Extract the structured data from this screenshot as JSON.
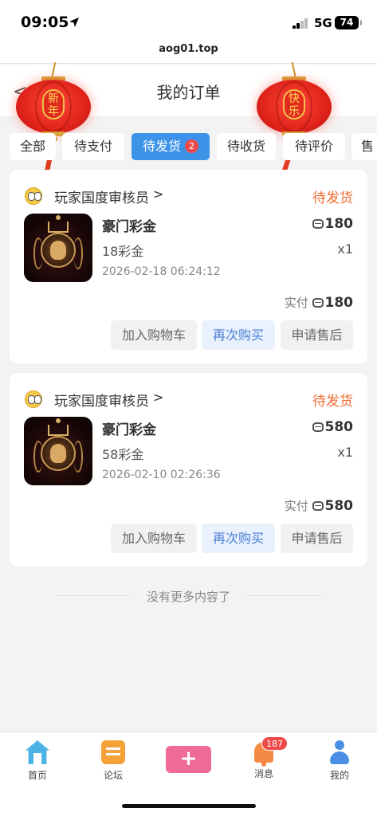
{
  "status_bar": {
    "time": "09:05",
    "network": "5G",
    "battery": "74"
  },
  "browser": {
    "url": "aog01.top"
  },
  "nav": {
    "back_symbol": "<",
    "title": "我的订单"
  },
  "lanterns": [
    {
      "text": "新年"
    },
    {
      "text": "快乐"
    }
  ],
  "tabs": [
    {
      "label": "全部"
    },
    {
      "label": "待支付"
    },
    {
      "label": "待发货",
      "badge": "2",
      "active": true
    },
    {
      "label": "待收货"
    },
    {
      "label": "待评价"
    },
    {
      "label": "售"
    }
  ],
  "orders": [
    {
      "shop_name": "玩家国度审核员",
      "chevron": ">",
      "status": "待发货",
      "product_name": "豪门彩金",
      "price": "180",
      "spec": "18彩金",
      "quantity": "x1",
      "time": "2026-02-18 06:24:12",
      "paid_label": "实付",
      "paid_amount": "180",
      "buttons": {
        "add_cart": "加入购物车",
        "rebuy": "再次购买",
        "after_sale": "申请售后"
      }
    },
    {
      "shop_name": "玩家国度审核员",
      "chevron": ">",
      "status": "待发货",
      "product_name": "豪门彩金",
      "price": "580",
      "spec": "58彩金",
      "quantity": "x1",
      "time": "2026-02-10 02:26:36",
      "paid_label": "实付",
      "paid_amount": "580",
      "buttons": {
        "add_cart": "加入购物车",
        "rebuy": "再次购买",
        "after_sale": "申请售后"
      }
    }
  ],
  "end_of_list": "没有更多内容了",
  "tabbar": {
    "home": "首页",
    "forum": "论坛",
    "post_symbol": "+",
    "messages": "消息",
    "messages_badge": "187",
    "mine": "我的"
  },
  "colors": {
    "accent": "#3d93e8",
    "status_orange": "#f06a2c",
    "badge_red": "#ee4a4a",
    "post_pink": "#ee6b96"
  }
}
